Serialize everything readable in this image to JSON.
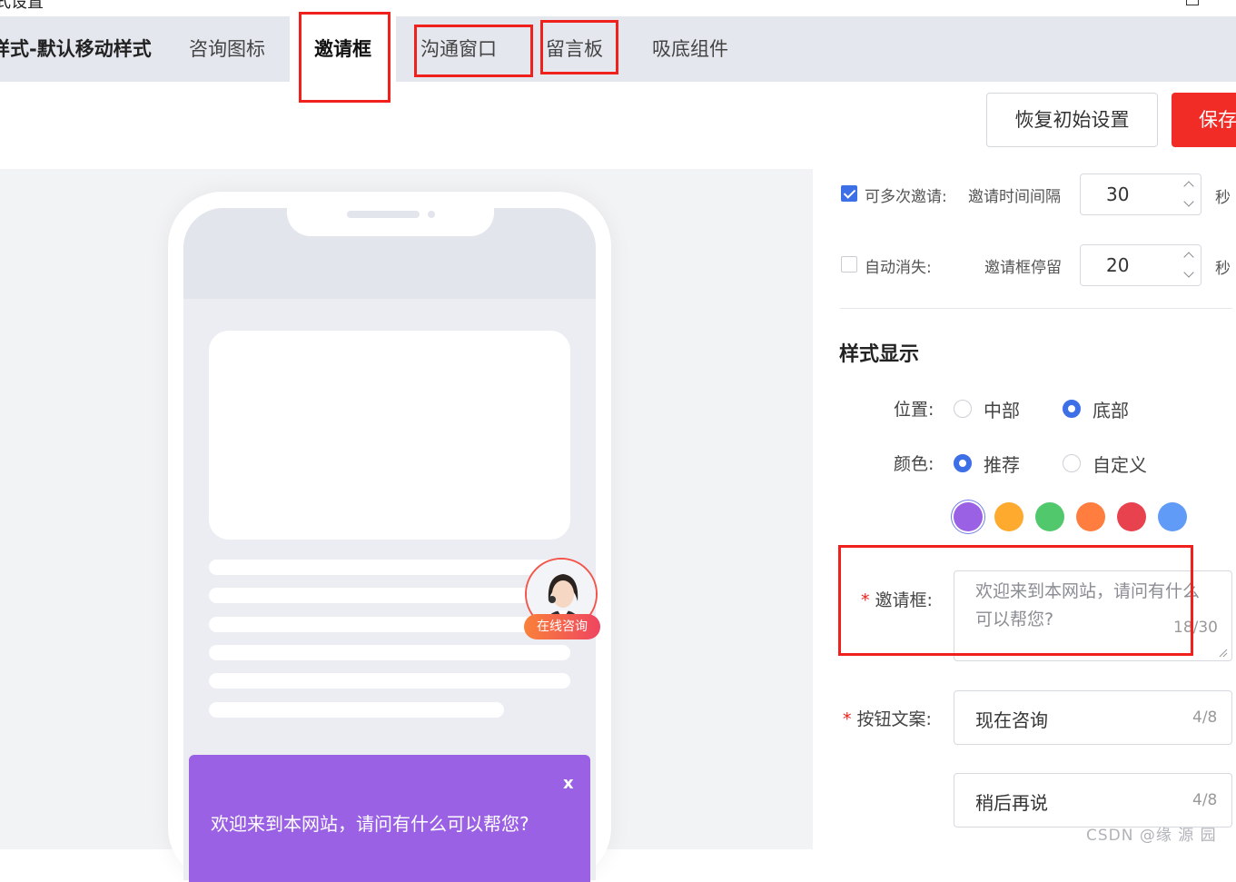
{
  "header": {
    "title": "式设置"
  },
  "tabs": [
    {
      "label": "样式-默认移动样式"
    },
    {
      "label": "咨询图标"
    },
    {
      "label": "邀请框"
    },
    {
      "label": "沟通窗口"
    },
    {
      "label": "留言板"
    },
    {
      "label": "吸底组件"
    }
  ],
  "toolbar": {
    "reset_label": "恢复初始设置",
    "save_label": "保存"
  },
  "preview": {
    "consult_badge": "在线咨询",
    "popup_close": "x",
    "popup_text": "欢迎来到本网站，请问有什么可以帮您?"
  },
  "settings": {
    "multi_invite": {
      "label": "可多次邀请:",
      "checked": true,
      "interval_label": "邀请时间间隔",
      "value": "30",
      "unit": "秒"
    },
    "auto_dismiss": {
      "label": "自动消失:",
      "checked": false,
      "stay_label": "邀请框停留",
      "value": "20",
      "unit": "秒"
    },
    "section_title": "样式显示",
    "position": {
      "label": "位置:",
      "options": [
        "中部",
        "底部"
      ],
      "selected": "底部"
    },
    "color": {
      "label": "颜色:",
      "options": [
        "推荐",
        "自定义"
      ],
      "selected": "推荐",
      "swatches": [
        "#9b61e4",
        "#fdaa2e",
        "#51c86c",
        "#fe7d3f",
        "#e8424f",
        "#619bf8"
      ],
      "selected_swatch": "#9b61e4"
    },
    "invite_box": {
      "required": "*",
      "label": "邀请框:",
      "value": "欢迎来到本网站，请问有什么可以帮您?",
      "count": "18/30"
    },
    "button_text": {
      "required": "*",
      "label": "按钮文案:",
      "value": "现在咨询",
      "count": "4/8"
    },
    "later_text": {
      "value": "稍后再说",
      "count": "4/8"
    }
  },
  "watermark": "CSDN @缘 源 园"
}
